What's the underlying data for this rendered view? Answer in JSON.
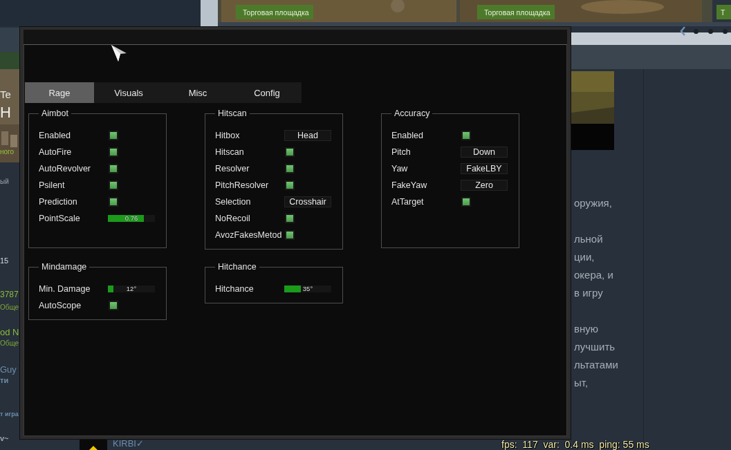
{
  "background": {
    "market_buttons": [
      "Торговая площадка",
      "Торговая площадка",
      "Т"
    ],
    "left_fragments": [
      {
        "text": "Te",
        "color": "#e8e8e8"
      },
      {
        "text": "H",
        "color": "#f0f0f0"
      },
      {
        "text": "ного",
        "color": "#9ac23c"
      },
      {
        "text": "ый",
        "color": "#9aa4ae"
      },
      {
        "text": "15",
        "color": "#d8dde2"
      },
      {
        "text": "3787",
        "color": "#8fba3a"
      },
      {
        "text": "Обще",
        "color": "#7fa63a"
      },
      {
        "text": "od N",
        "color": "#8fba3a"
      },
      {
        "text": "Обще",
        "color": "#7fa63a"
      },
      {
        "text": "Guy",
        "color": "#6e8eae"
      },
      {
        "text": "ти",
        "color": "#6e8eae"
      },
      {
        "text": "т игра",
        "color": "#6e8eae"
      },
      {
        "text": "v~",
        "color": "#9aa4ae"
      }
    ],
    "right_fragments": [
      "оружия,",
      "льной",
      "ции,",
      "окера, и",
      "в игру",
      "вную",
      "лучшить",
      "льтатами",
      "ыт,"
    ],
    "footer_name": "KIRBI✓",
    "net_stats": "fps:  117  var:  0.4 ms  ping: 55 ms"
  },
  "tabs": [
    {
      "label": "Rage",
      "selected": true
    },
    {
      "label": "Visuals",
      "selected": false
    },
    {
      "label": "Misc",
      "selected": false
    },
    {
      "label": "Config",
      "selected": false
    }
  ],
  "groups": [
    {
      "title": "Aimbot",
      "rows": [
        {
          "kind": "checkbox",
          "label": "Enabled",
          "checked": true
        },
        {
          "kind": "checkbox",
          "label": "AutoFire",
          "checked": true
        },
        {
          "kind": "checkbox",
          "label": "AutoRevolver",
          "checked": true
        },
        {
          "kind": "checkbox",
          "label": "Psilent",
          "checked": true
        },
        {
          "kind": "checkbox",
          "label": "Prediction",
          "checked": true
        },
        {
          "kind": "slider",
          "label": "PointScale",
          "level": 0.76,
          "reading": "0.76"
        }
      ]
    },
    {
      "title": "Hitscan",
      "rows": [
        {
          "kind": "dropdown",
          "label": "Hitbox",
          "value": "Head"
        },
        {
          "kind": "checkbox",
          "label": "Hitscan",
          "checked": true
        },
        {
          "kind": "checkbox",
          "label": "Resolver",
          "checked": true
        },
        {
          "kind": "checkbox",
          "label": "PitchResolver",
          "checked": true
        },
        {
          "kind": "dropdown",
          "label": "Selection",
          "value": "Crosshair"
        },
        {
          "kind": "checkbox",
          "label": "NoRecoil",
          "checked": true
        },
        {
          "kind": "checkbox",
          "label": "AvozFakesMetod",
          "checked": true
        }
      ]
    },
    {
      "title": "Accuracy",
      "rows": [
        {
          "kind": "checkbox",
          "label": "Enabled",
          "checked": true
        },
        {
          "kind": "dropdown",
          "label": "Pitch",
          "value": "Down"
        },
        {
          "kind": "dropdown",
          "label": "Yaw",
          "value": "FakeLBY"
        },
        {
          "kind": "dropdown",
          "label": "FakeYaw",
          "value": "Zero"
        },
        {
          "kind": "checkbox",
          "label": "AtTarget",
          "checked": true
        }
      ]
    },
    {
      "title": "Mindamage",
      "rows": [
        {
          "kind": "slider",
          "label": "Min. Damage",
          "level": 0.12,
          "reading": "12°"
        },
        {
          "kind": "checkbox",
          "label": "AutoScope",
          "checked": true
        }
      ]
    },
    {
      "title": "Hitchance",
      "rows": [
        {
          "kind": "slider",
          "label": "Hitchance",
          "level": 0.35,
          "reading": "35°"
        }
      ]
    }
  ]
}
